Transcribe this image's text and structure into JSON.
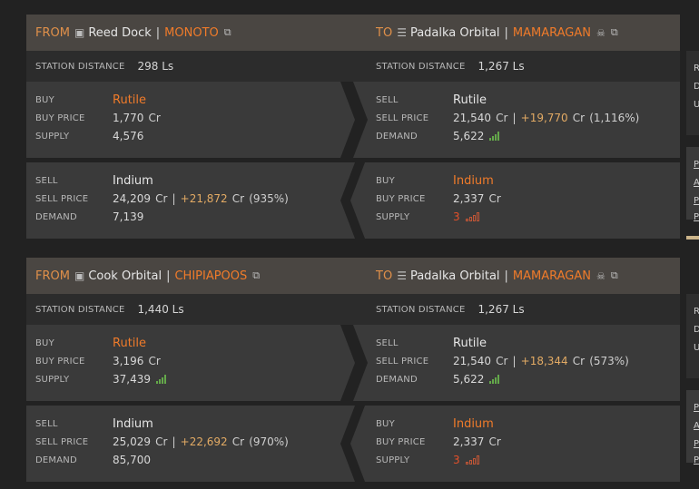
{
  "routes": [
    {
      "from": {
        "label": "FROM",
        "station": "Reed Dock",
        "system": "MONOTO",
        "distance_label": "STATION DISTANCE",
        "distance": "298 Ls"
      },
      "to": {
        "label": "TO",
        "station": "Padalka Orbital",
        "system": "MAMARAGAN",
        "distance_label": "STATION DISTANCE",
        "distance": "1,267 Ls"
      },
      "outbound": {
        "buy": {
          "label": "BUY",
          "commodity": "Rutile",
          "price_label": "BUY PRICE",
          "price": "1,770",
          "unit": "Cr",
          "qty_label": "SUPPLY",
          "qty": "4,576"
        },
        "sell": {
          "label": "SELL",
          "commodity": "Rutile",
          "price_label": "SELL PRICE",
          "price": "21,540",
          "unit": "Cr",
          "profit": "+19,770",
          "profit_unit": "Cr",
          "percent": "(1,116%)",
          "qty_label": "DEMAND",
          "qty": "5,622"
        }
      },
      "return": {
        "sell": {
          "label": "SELL",
          "commodity": "Indium",
          "price_label": "SELL PRICE",
          "price": "24,209",
          "unit": "Cr",
          "profit": "+21,872",
          "profit_unit": "Cr",
          "percent": "(935%)",
          "qty_label": "DEMAND",
          "qty": "7,139"
        },
        "buy": {
          "label": "BUY",
          "commodity": "Indium",
          "price_label": "BUY PRICE",
          "price": "2,337",
          "unit": "Cr",
          "qty_label": "SUPPLY",
          "qty": "3"
        }
      }
    },
    {
      "from": {
        "label": "FROM",
        "station": "Cook Orbital",
        "system": "CHIPIAPOOS",
        "distance_label": "STATION DISTANCE",
        "distance": "1,440 Ls"
      },
      "to": {
        "label": "TO",
        "station": "Padalka Orbital",
        "system": "MAMARAGAN",
        "distance_label": "STATION DISTANCE",
        "distance": "1,267 Ls"
      },
      "outbound": {
        "buy": {
          "label": "BUY",
          "commodity": "Rutile",
          "price_label": "BUY PRICE",
          "price": "3,196",
          "unit": "Cr",
          "qty_label": "SUPPLY",
          "qty": "37,439"
        },
        "sell": {
          "label": "SELL",
          "commodity": "Rutile",
          "price_label": "SELL PRICE",
          "price": "21,540",
          "unit": "Cr",
          "profit": "+18,344",
          "profit_unit": "Cr",
          "percent": "(573%)",
          "qty_label": "DEMAND",
          "qty": "5,622"
        }
      },
      "return": {
        "sell": {
          "label": "SELL",
          "commodity": "Indium",
          "price_label": "SELL PRICE",
          "price": "25,029",
          "unit": "Cr",
          "profit": "+22,692",
          "profit_unit": "Cr",
          "percent": "(970%)",
          "qty_label": "DEMAND",
          "qty": "85,700"
        },
        "buy": {
          "label": "BUY",
          "commodity": "Indium",
          "price_label": "BUY PRICE",
          "price": "2,337",
          "unit": "Cr",
          "qty_label": "SUPPLY",
          "qty": "3"
        }
      }
    }
  ],
  "side_stub": {
    "top_letters": [
      "R",
      "D",
      "U"
    ],
    "bottom_letters": [
      "P",
      "A",
      "P",
      "P"
    ]
  },
  "colors": {
    "accent": "#f07b2a",
    "header": "#4a4642",
    "panel": "#3a3a3a",
    "profit": "#e2aa64",
    "supply_high": "#64a84a",
    "supply_low": "#e4502a"
  }
}
